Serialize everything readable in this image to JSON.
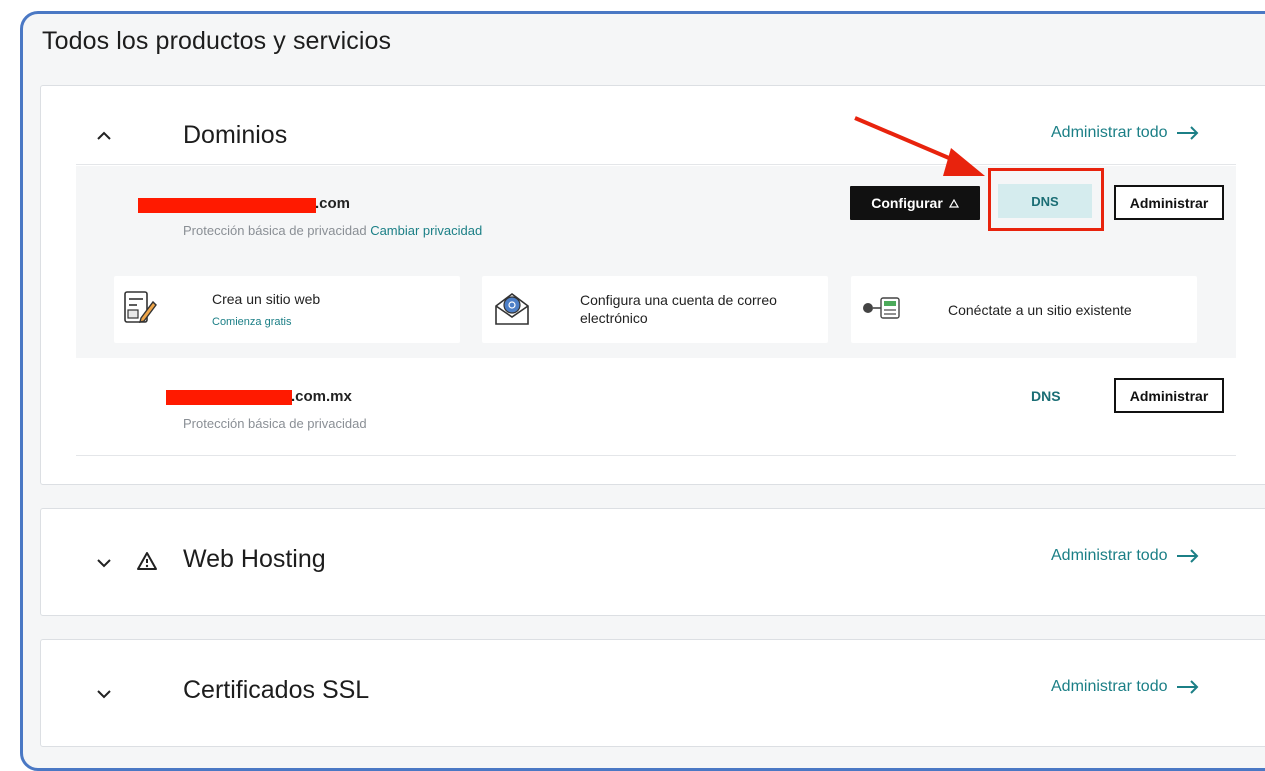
{
  "page": {
    "title": "Todos los productos y servicios"
  },
  "colors": {
    "accent": "#1b7f86",
    "highlight": "#e8230d",
    "frame": "#4a78c4"
  },
  "domains": {
    "title": "Dominios",
    "manage_all": "Administrar todo",
    "items": [
      {
        "suffix": ".com",
        "privacy": "Protección básica de privacidad",
        "privacy_link": "Cambiar privacidad",
        "configure_label": "Configurar",
        "dns_label": "DNS",
        "admin_label": "Administrar"
      },
      {
        "suffix": ".com.mx",
        "privacy": "Protección básica de privacidad",
        "dns_label": "DNS",
        "admin_label": "Administrar"
      }
    ],
    "cards": [
      {
        "title": "Crea un sitio web",
        "link": "Comienza gratis",
        "icon": "website-builder-icon"
      },
      {
        "title": "Configura una cuenta de correo electrónico",
        "icon": "email-icon"
      },
      {
        "title": "Conéctate a un sitio existente",
        "icon": "connect-site-icon"
      }
    ]
  },
  "hosting": {
    "title": "Web Hosting",
    "manage_all": "Administrar todo",
    "icon": "warning-icon"
  },
  "ssl": {
    "title": "Certificados SSL",
    "manage_all": "Administrar todo"
  }
}
